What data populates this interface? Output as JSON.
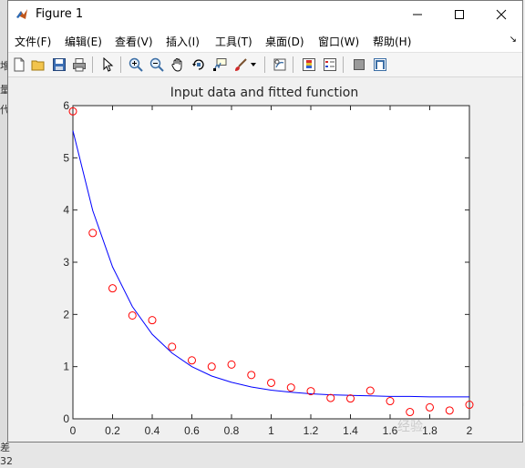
{
  "window": {
    "title": "Figure 1"
  },
  "menu": [
    {
      "label": "文件(F)",
      "key": "file"
    },
    {
      "label": "编辑(E)",
      "key": "edit"
    },
    {
      "label": "查看(V)",
      "key": "view"
    },
    {
      "label": "插入(I)",
      "key": "insert"
    },
    {
      "label": "工具(T)",
      "key": "tools"
    },
    {
      "label": "桌面(D)",
      "key": "desktop"
    },
    {
      "label": "窗口(W)",
      "key": "window"
    },
    {
      "label": "帮助(H)",
      "key": "help"
    }
  ],
  "toolbar": [
    "new-figure-icon",
    "open-file-icon",
    "save-icon",
    "print-icon",
    "pointer-icon",
    "zoom-in-icon",
    "zoom-out-icon",
    "pan-hand-icon",
    "rotate-3d-icon",
    "data-cursor-icon",
    "brush-icon",
    "link-plot-icon",
    "insert-colorbar-icon",
    "insert-legend-icon",
    "hide-plot-tools-icon",
    "show-plot-tools-icon"
  ],
  "background_fragments": {
    "left1": "堆",
    "left2": "量",
    "left3": "代",
    "bottom1": "差",
    "bottom2": "32",
    "right1": "t",
    "right2": "h"
  },
  "watermark": "经验",
  "chart_data": {
    "type": "scatter",
    "title": "Input data and fitted function",
    "xlabel": "",
    "ylabel": "",
    "xlim": [
      0,
      2
    ],
    "ylim": [
      0,
      6
    ],
    "xticks": [
      0,
      0.2,
      0.4,
      0.6,
      0.8,
      1,
      1.2,
      1.4,
      1.6,
      1.8,
      2
    ],
    "yticks": [
      0,
      1,
      2,
      3,
      4,
      5,
      6
    ],
    "xtick_labels": [
      "0",
      "0.2",
      "0.4",
      "0.6",
      "0.8",
      "1",
      "1.2",
      "1.4",
      "1.6",
      "1.8",
      "2"
    ],
    "ytick_labels": [
      "0",
      "1",
      "2",
      "3",
      "4",
      "5",
      "6"
    ],
    "grid": false,
    "series": [
      {
        "kind": "markers",
        "color": "#ff0000",
        "marker": "o",
        "x": [
          0,
          0.1,
          0.2,
          0.3,
          0.4,
          0.5,
          0.6,
          0.7,
          0.8,
          0.9,
          1.0,
          1.1,
          1.2,
          1.3,
          1.4,
          1.5,
          1.6,
          1.7,
          1.8,
          1.9,
          2.0
        ],
        "y": [
          5.89,
          3.56,
          2.5,
          1.98,
          1.89,
          1.38,
          1.12,
          1.0,
          1.04,
          0.84,
          0.69,
          0.6,
          0.53,
          0.4,
          0.39,
          0.54,
          0.34,
          0.13,
          0.22,
          0.16,
          0.27
        ]
      },
      {
        "kind": "line",
        "color": "#0000ff",
        "x": [
          0,
          0.1,
          0.2,
          0.3,
          0.4,
          0.5,
          0.6,
          0.7,
          0.8,
          0.9,
          1.0,
          1.1,
          1.2,
          1.3,
          1.4,
          1.5,
          1.6,
          1.7,
          1.8,
          1.9,
          2.0
        ],
        "y": [
          5.52,
          3.99,
          2.91,
          2.15,
          1.62,
          1.26,
          1.0,
          0.82,
          0.7,
          0.61,
          0.55,
          0.51,
          0.48,
          0.46,
          0.45,
          0.44,
          0.43,
          0.43,
          0.42,
          0.42,
          0.42
        ]
      }
    ]
  }
}
